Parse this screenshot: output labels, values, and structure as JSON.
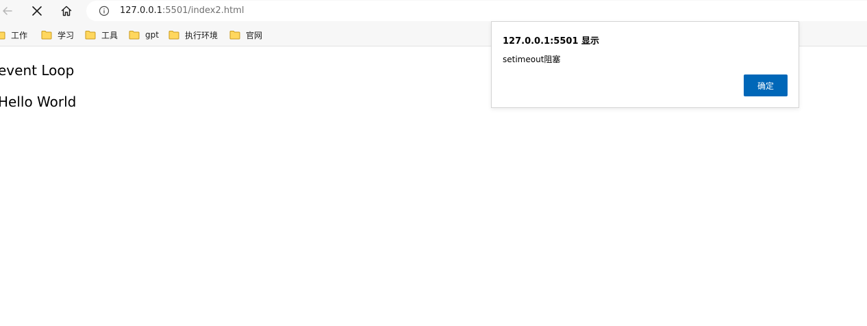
{
  "toolbar": {
    "back_icon": "arrow-left-icon",
    "stop_icon": "close-icon",
    "home_icon": "home-icon"
  },
  "address_bar": {
    "host": "127.0.0.1",
    "path": ":5501/index2.html",
    "info_icon": "info-icon"
  },
  "bookmarks": [
    {
      "label": "工作"
    },
    {
      "label": "学习"
    },
    {
      "label": "工具"
    },
    {
      "label": "gpt"
    },
    {
      "label": "执行环境"
    },
    {
      "label": "官网"
    }
  ],
  "page": {
    "line1": "event Loop",
    "line2": "Hello World"
  },
  "dialog": {
    "title": "127.0.0.1:5501 显示",
    "message": "setimeout阻塞",
    "ok_label": "确定"
  },
  "colors": {
    "accent": "#0067b8",
    "folder_fill": "#ffd75e",
    "folder_stroke": "#c89a1c",
    "toolbar_bg": "#f7f7f7"
  }
}
